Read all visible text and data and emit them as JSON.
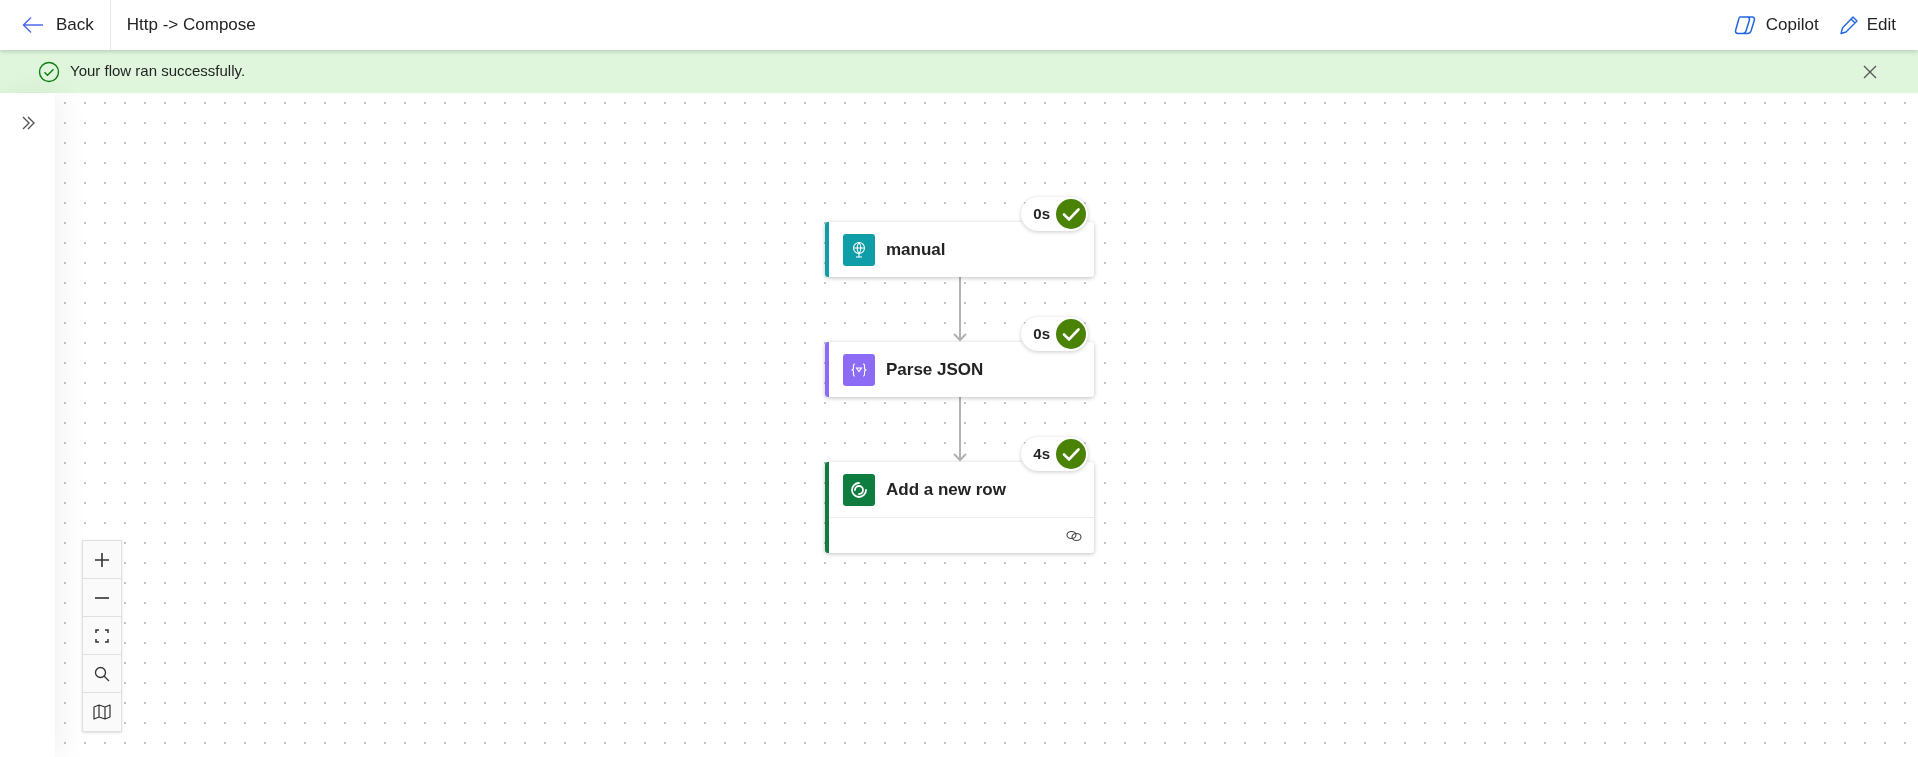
{
  "header": {
    "back": "Back",
    "title": "Http -> Compose",
    "actions": [
      {
        "kind": "copilot",
        "label": "Copilot"
      },
      {
        "kind": "edit",
        "label": "Edit"
      }
    ]
  },
  "banner": {
    "message": "Your flow ran successfully."
  },
  "flow": {
    "steps": [
      {
        "kind": "trigger",
        "title": "manual",
        "duration": "0s",
        "succeeded": true,
        "color": "#0f9ea8",
        "connection_footer": false
      },
      {
        "kind": "parse",
        "title": "Parse JSON",
        "duration": "0s",
        "succeeded": true,
        "color": "#8c6cf5",
        "connection_footer": false
      },
      {
        "kind": "dataverse",
        "title": "Add a new row",
        "duration": "4s",
        "succeeded": true,
        "color": "#0f7d3f",
        "connection_footer": true
      }
    ]
  }
}
